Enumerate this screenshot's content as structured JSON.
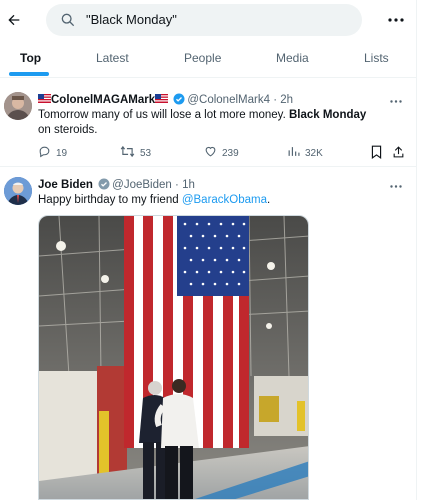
{
  "search": {
    "query": "\"Black Monday\""
  },
  "tabs": [
    {
      "label": "Top",
      "active": true
    },
    {
      "label": "Latest",
      "active": false
    },
    {
      "label": "People",
      "active": false
    },
    {
      "label": "Media",
      "active": false
    },
    {
      "label": "Lists",
      "active": false
    }
  ],
  "tweets": [
    {
      "display_name": "ColonelMAGAMark",
      "handle": "@ColonelMark4",
      "time": "2h",
      "text_before": "Tomorrow many of us will lose a lot more money. ",
      "text_bold": "Black Monday",
      "text_after": " on steroids.",
      "replies": "19",
      "reposts": "53",
      "likes": "239",
      "views": "32K"
    },
    {
      "display_name": "Joe Biden",
      "handle": "@JoeBiden",
      "time": "1h",
      "text_before": "Happy birthday to my friend ",
      "mention": "@BarackObama",
      "text_after": "."
    }
  ],
  "colors": {
    "accent": "#1d9bf0",
    "text": "#0f1419",
    "muted": "#536471",
    "border": "#eff3f4"
  },
  "icons": [
    "back-arrow-icon",
    "search-icon",
    "more-icon",
    "verified-badge-icon",
    "flag-icon",
    "reply-icon",
    "repost-icon",
    "like-icon",
    "views-icon",
    "bookmark-icon",
    "share-icon"
  ]
}
